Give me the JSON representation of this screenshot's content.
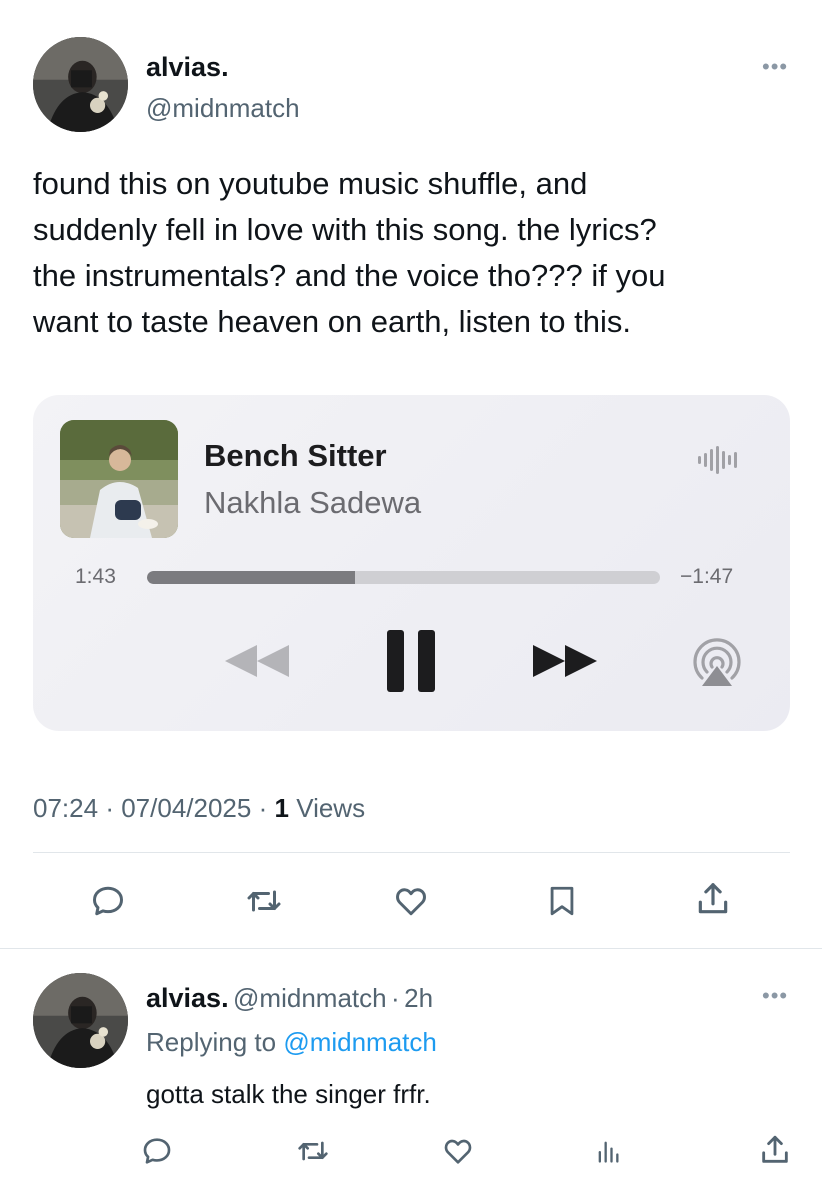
{
  "tweet": {
    "author_name": "alvias.",
    "author_handle": "@midnmatch",
    "more": "•••",
    "text_lines": [
      "found this on youtube music shuffle, and",
      "suddenly fell in love with this song. the lyrics?",
      "the instrumentals? and the voice tho??? if you",
      "want to taste heaven on earth, listen to this."
    ],
    "time": "07:24",
    "sep1": "·",
    "date": "07/04/2025",
    "sep2": "·",
    "views_count": "1",
    "views_label": "Views"
  },
  "player": {
    "title": "Bench Sitter",
    "artist": "Nakhla Sadewa",
    "elapsed": "1:43",
    "remaining": "−1:47",
    "progress": 0.405
  },
  "reply": {
    "author_name": "alvias.",
    "author_handle": "@midnmatch",
    "sep": "·",
    "age": "2h",
    "more": "•••",
    "replying_prefix": "Replying to",
    "replying_handle": "@midnmatch",
    "text": "gotta stalk the singer frfr."
  },
  "icons": {
    "reply": "comment-icon",
    "retweet": "retweet-icon",
    "like": "heart-icon",
    "bookmark": "bookmark-icon",
    "share": "share-icon",
    "analytics": "analytics-icon"
  },
  "colors": {
    "text": "#0f1419",
    "secondary": "#536471",
    "link": "#1d9bf0",
    "divider": "#e1e6ea"
  }
}
